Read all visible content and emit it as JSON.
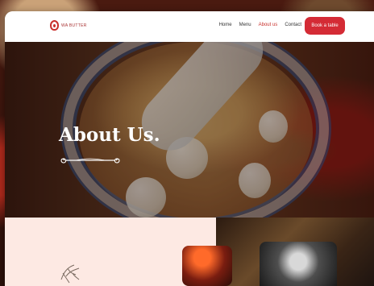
{
  "header": {
    "logo_text": "WA BUTTER",
    "nav": [
      {
        "label": "Home",
        "active": false
      },
      {
        "label": "Menu",
        "active": false
      },
      {
        "label": "About us",
        "active": true
      },
      {
        "label": "Contact",
        "active": false
      }
    ],
    "book_label": "Book a table"
  },
  "hero": {
    "title": "About Us."
  },
  "colors": {
    "accent": "#d42b35",
    "hero_text": "#ffffff",
    "lower_bg": "#fde9e3"
  },
  "icons": {
    "logo": "flame-logo-icon",
    "divider": "ornamental-divider-icon",
    "sketch": "decorative-sketch-icon"
  }
}
